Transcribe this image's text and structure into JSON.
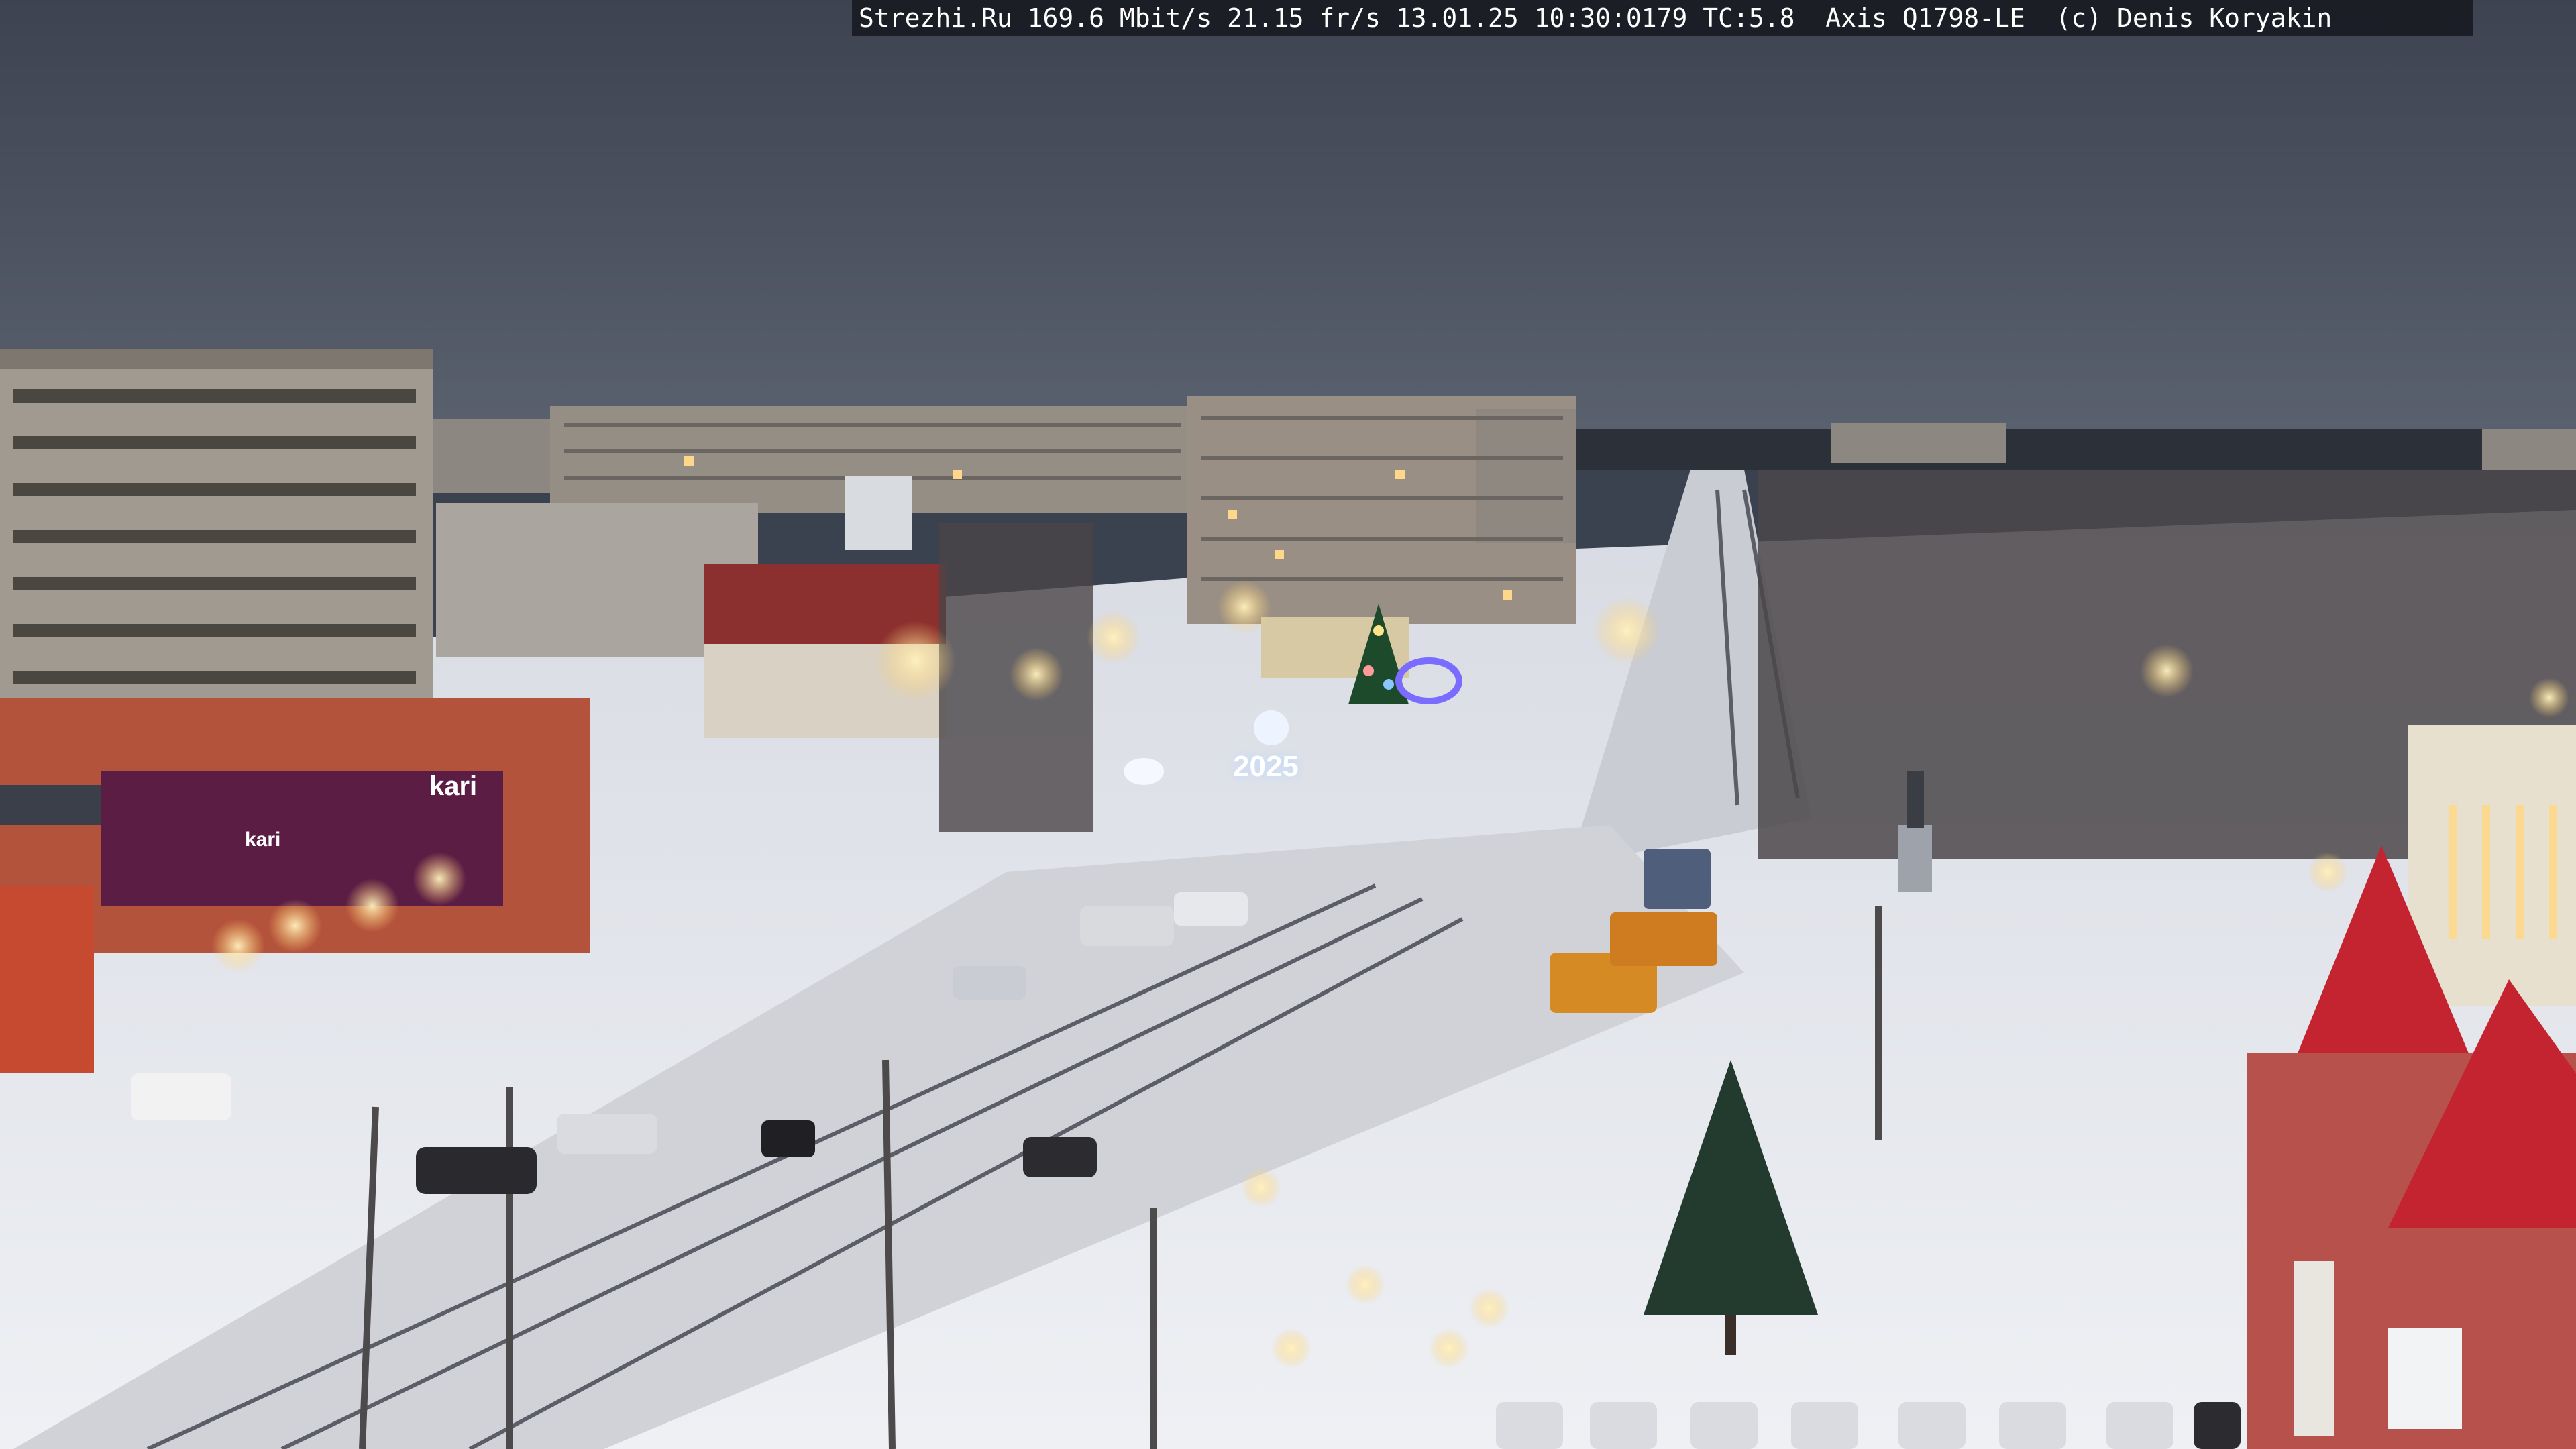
{
  "osd": {
    "text": "Strezhi.Ru 169.6 Mbit/s 21.15 fr/s 13.01.25 10:30:0179 TC:5.8  Axis Q1798-LE  (c) Denis Koryakin"
  },
  "signs": {
    "store_logo": "kari",
    "store_logo_2": "kari",
    "year": "2025"
  },
  "colors": {
    "sky": "#434a58",
    "snow": "#e6e8ee",
    "brick": "#b4533c",
    "panel_building": "#9a9188",
    "lamp_glow": "#ffd98a",
    "festive_blue": "#7a6cff"
  }
}
